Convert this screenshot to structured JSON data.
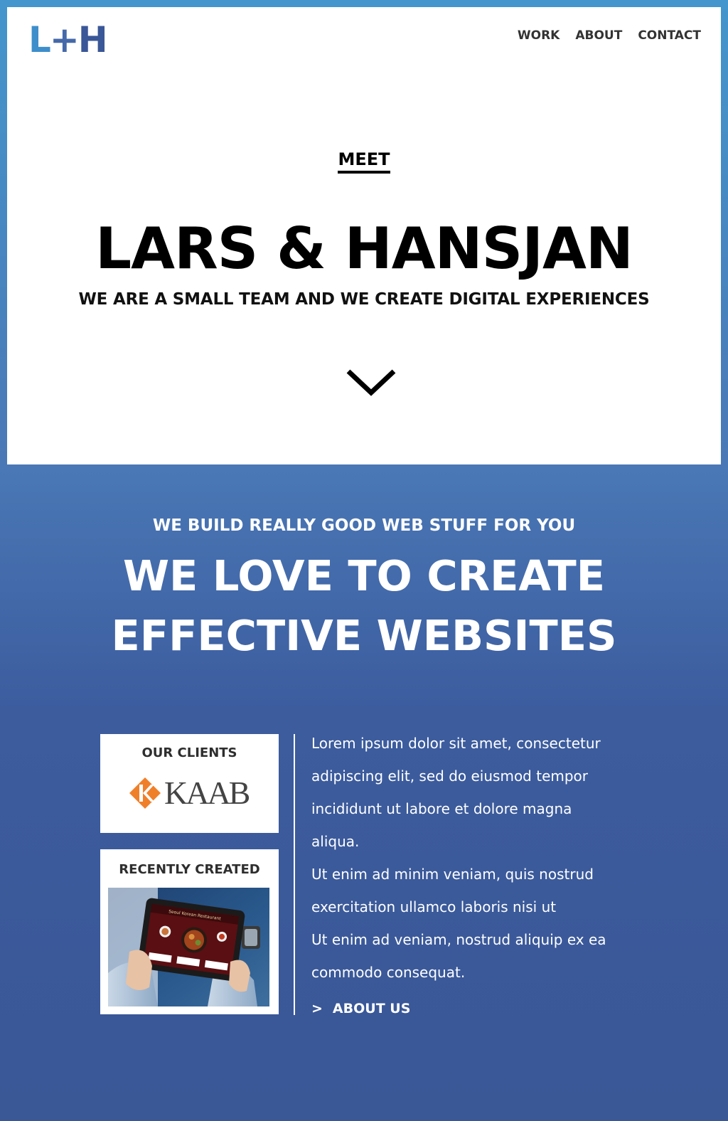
{
  "brand": {
    "logo_l": "L",
    "logo_plus": "+",
    "logo_h": "H",
    "colors": {
      "light_blue": "#3d8ecb",
      "dark_blue": "#3a5797"
    }
  },
  "nav": {
    "items": [
      {
        "label": "WORK"
      },
      {
        "label": "ABOUT"
      },
      {
        "label": "CONTACT"
      }
    ]
  },
  "hero": {
    "kicker": "MEET",
    "title": "LARS & HANSJAN",
    "subtitle": "WE ARE A SMALL TEAM AND WE CREATE DIGITAL EXPERIENCES",
    "scroll_icon": "chevron-down-icon"
  },
  "intro": {
    "kicker": "WE BUILD REALLY GOOD WEB STUFF FOR YOU",
    "headline_lines": [
      "WE LOVE TO CREATE",
      "EFFECTIVE WEBSITES"
    ]
  },
  "clients": {
    "title": "OUR CLIENTS",
    "logo_text": "KAAB",
    "logo_accent": "#f07f2a"
  },
  "recent": {
    "title": "RECENTLY CREATED",
    "screen_text": "Seoul Korean Restaurant"
  },
  "about": {
    "paragraphs": [
      "Lorem ipsum dolor sit amet, consectetur adipiscing elit, sed do eiusmod tempor incididunt ut labore et dolore magna aliqua.",
      "Ut enim ad minim veniam, quis nostrud exercitation ullamco laboris nisi ut",
      "Ut enim ad veniam, nostrud aliquip ex ea commodo consequat."
    ],
    "link_arrow": ">",
    "link_label": "ABOUT US"
  }
}
